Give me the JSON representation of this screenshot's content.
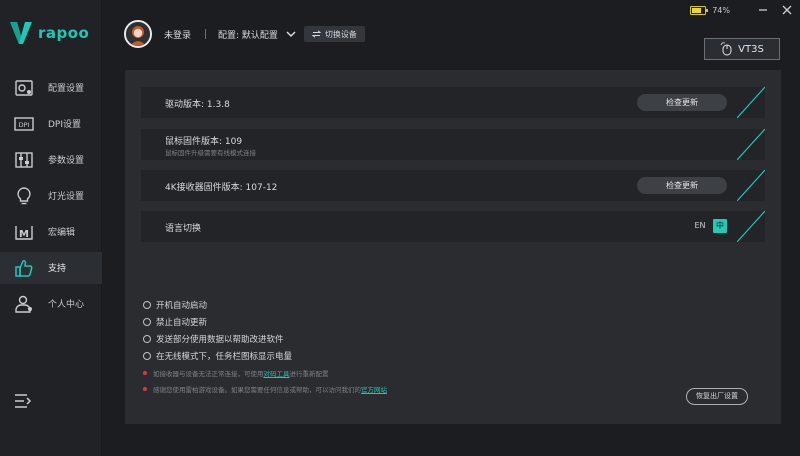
{
  "app": {
    "brand": "rapoo"
  },
  "window": {
    "battery_percent": "74%",
    "battery_level": 0.74,
    "battery_color": "#e7d72f"
  },
  "user": {
    "login_status": "未登录",
    "config_label": "配置: 默认配置",
    "switch_device_label": "切换设备"
  },
  "device": {
    "name": "VT3S"
  },
  "sidebar": {
    "items": [
      {
        "label": "配置设置",
        "icon": "config-icon"
      },
      {
        "label": "DPI设置",
        "icon": "dpi-icon"
      },
      {
        "label": "参数设置",
        "icon": "sliders-icon"
      },
      {
        "label": "灯光设置",
        "icon": "lightbulb-icon"
      },
      {
        "label": "宏编辑",
        "icon": "macro-icon"
      },
      {
        "label": "支持",
        "icon": "thumbs-up-icon",
        "active": true
      },
      {
        "label": "个人中心",
        "icon": "user-icon"
      }
    ]
  },
  "info_rows": {
    "driver": {
      "title": "驱动版本: 1.3.8",
      "button": "检查更新"
    },
    "mouse_fw": {
      "title": "鼠标固件版本: 109",
      "subtitle": "鼠标固件升级需要有线模式连接"
    },
    "receiver_fw": {
      "title": "4K接收器固件版本: 107-12",
      "button": "检查更新"
    },
    "language": {
      "title": "语言切换",
      "option_en": "EN",
      "option_zh": "中"
    }
  },
  "options": [
    "开机自动启动",
    "禁止自动更新",
    "发送部分使用数据以帮助改进软件",
    "在无线模式下，任务栏图标显示电量"
  ],
  "notes": {
    "note1_before": "如接收器与设备无法正常连接，可使用",
    "note1_link": "对码工具",
    "note1_after": "进行重新配置",
    "note2_before": "感谢您使用雷柏游戏设备。如果您需要任何信息或帮助，可以访问我们的",
    "note2_link": "官方网站"
  },
  "factory_reset_label": "恢复出厂设置",
  "colors": {
    "accent": "#22c6b4",
    "background": "#1b1d21",
    "panel": "#2a2c30",
    "row": "#222428",
    "note_dot": "#e0324b"
  }
}
